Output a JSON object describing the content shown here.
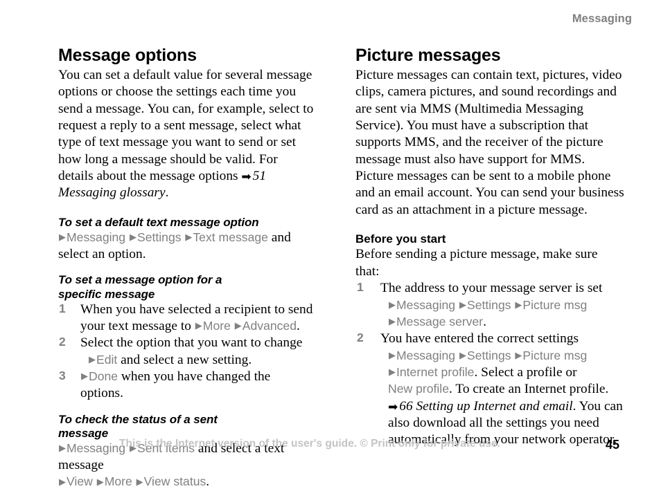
{
  "header": {
    "running_title": "Messaging"
  },
  "icons": {
    "triangle": "▶",
    "xref_arrow": "➡"
  },
  "colors": {
    "ui_text_grey": "#808080",
    "footer_grey": "#c4c4c4",
    "body_black": "#000000"
  },
  "left_column": {
    "section_title": "Message options",
    "intro": {
      "text_before_xref": "You can set a default value for several message options or choose the settings each time you send a message. You can, for example, select to request a reply to a sent message, select what type of text message you want to send or set how long a message should be valid. For details about the message options ",
      "xref": "51 Messaging glossary",
      "text_after_xref": "."
    },
    "proc1": {
      "title": "To set a default text message option",
      "ui1": "Messaging",
      "ui2": "Settings",
      "ui3": "Text message",
      "tail": " and select an option."
    },
    "proc2": {
      "title_line1": "To set a message option for a",
      "title_line2": "specific message",
      "steps": [
        {
          "num": "1",
          "text_a": "When you have selected a recipient to send your text message to ",
          "ui1": "More",
          "ui2": "Advanced",
          "text_b": "."
        },
        {
          "num": "2",
          "text_a": "Select the option that you want to change",
          "ui1": "Edit",
          "text_b": " and select a new setting."
        },
        {
          "num": "3",
          "ui1": "Done",
          "text_b": " when you have changed the options."
        }
      ]
    },
    "proc3": {
      "title_line1": "To check the status of a sent",
      "title_line2": "message",
      "ui1": "Messaging",
      "ui2": "Sent items",
      "mid": " and select a text message",
      "ui3": "View",
      "ui4": "More",
      "ui5": "View status",
      "tail": "."
    }
  },
  "right_column": {
    "section_title": "Picture messages",
    "intro": "Picture messages can contain text, pictures, video clips, camera pictures, and sound recordings and are sent via MMS (Multimedia Messaging Service). You must have a subscription that supports MMS, and the receiver of the picture message must also have support for MMS. Picture messages can be sent to a mobile phone and an email account. You can send your business card as an attachment in a picture message.",
    "before_you_start": {
      "title": "Before you start",
      "lead": "Before sending a picture message, make sure that:",
      "steps": [
        {
          "num": "1",
          "text_a": "The address to your message server is set",
          "ui1": "Messaging",
          "ui2": "Settings",
          "ui3": "Picture msg",
          "ui4": "Message server",
          "text_b": "."
        },
        {
          "num": "2",
          "text_a": "You have entered the correct settings",
          "ui1": "Messaging",
          "ui2": "Settings",
          "ui3": "Picture msg",
          "ui4": "Internet profile",
          "text_b": ". Select a profile or ",
          "ui5": "New profile",
          "text_c": ". To create an Internet profile. ",
          "xref": "66 Setting up Internet and email",
          "text_d": ". You can also download all the settings you need automatically from your network operator."
        }
      ]
    }
  },
  "footer": {
    "note": "This is the Internet version of the user's guide. © Print only for private use.",
    "page_number": "45"
  }
}
